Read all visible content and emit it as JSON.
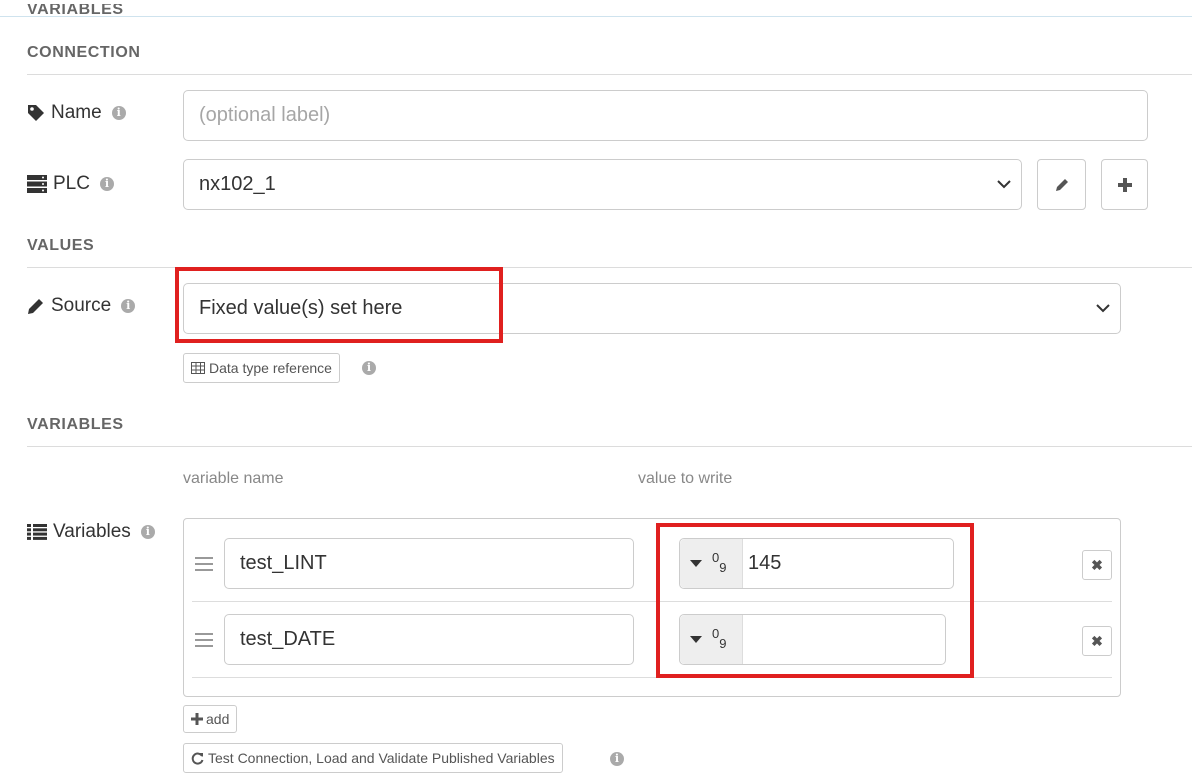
{
  "top_cut_title": "VARIABLES",
  "sections": {
    "connection": "CONNECTION",
    "values": "VALUES",
    "variables": "VARIABLES"
  },
  "name_field": {
    "label": "Name",
    "placeholder": "(optional label)"
  },
  "plc_field": {
    "label": "PLC",
    "value": "nx102_1"
  },
  "source_field": {
    "label": "Source",
    "value": "Fixed value(s) set here"
  },
  "data_type_ref_label": "Data type reference",
  "variables": {
    "label": "Variables",
    "col_name": "variable name",
    "col_value": "value to write",
    "rows": [
      {
        "name": "test_LINT",
        "value": "145"
      },
      {
        "name": "test_DATE",
        "value": ""
      }
    ],
    "add_label": "add",
    "test_label": "Test Connection, Load and Validate Published Variables"
  },
  "colors": {
    "highlight": "#e0201f"
  }
}
